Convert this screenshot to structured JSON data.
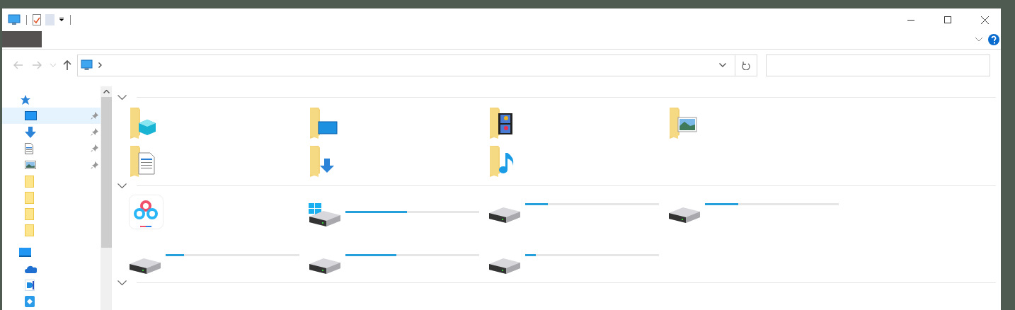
{
  "ribbon": {
    "tabs": [
      {
        "kind": "file",
        "selected": false
      }
    ]
  },
  "sidebar": {
    "items": [
      {
        "kind": "quick-access",
        "selected": false,
        "pinned": false,
        "children": [
          {
            "kind": "desktop",
            "selected": true,
            "pinned": true
          },
          {
            "kind": "downloads",
            "selected": false,
            "pinned": true
          },
          {
            "kind": "documents",
            "selected": false,
            "pinned": true
          },
          {
            "kind": "pictures",
            "selected": false,
            "pinned": true
          },
          {
            "kind": "folder",
            "selected": false,
            "pinned": false
          },
          {
            "kind": "folder",
            "selected": false,
            "pinned": false
          },
          {
            "kind": "folder",
            "selected": false,
            "pinned": false
          },
          {
            "kind": "folder",
            "selected": false,
            "pinned": false
          }
        ]
      },
      {
        "kind": "this-pc",
        "selected": false,
        "pinned": false,
        "children": [
          {
            "kind": "onedrive",
            "selected": false,
            "pinned": false
          },
          {
            "kind": "app-d",
            "selected": false,
            "pinned": false
          },
          {
            "kind": "app-sync",
            "selected": false,
            "pinned": false
          }
        ]
      }
    ]
  },
  "sections": [
    {
      "expanded": true,
      "items": [
        {
          "kind": "objects"
        },
        {
          "kind": "desktop"
        },
        {
          "kind": "videos"
        },
        {
          "kind": "pictures"
        },
        {
          "kind": "documents"
        },
        {
          "kind": "downloads"
        },
        {
          "kind": "music"
        }
      ]
    },
    {
      "expanded": true,
      "items": [
        {
          "kind": "app"
        },
        {
          "kind": "system-drive",
          "level": 0.46
        },
        {
          "kind": "drive",
          "level": 0.17
        },
        {
          "kind": "drive",
          "level": 0.25
        },
        {
          "kind": "drive",
          "level": 0.14
        },
        {
          "kind": "drive",
          "level": 0.38
        },
        {
          "kind": "drive",
          "level": 0.08
        }
      ]
    },
    {
      "expanded": true
    }
  ]
}
